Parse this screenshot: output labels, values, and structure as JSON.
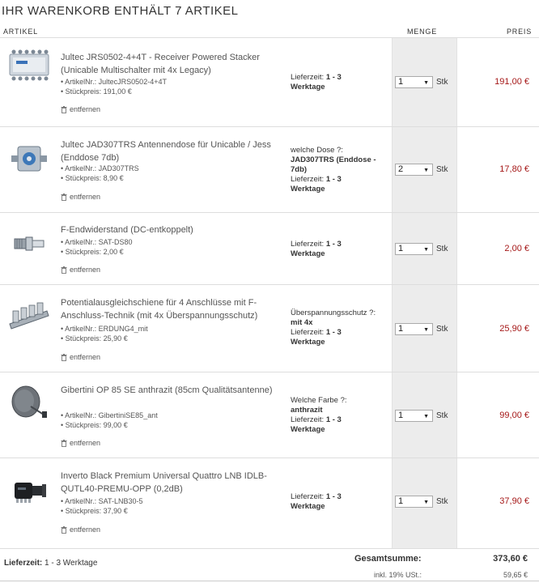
{
  "title": "IHR WARENKORB ENTHÄLT 7 ARTIKEL",
  "columns": {
    "artikel": "ARTIKEL",
    "menge": "MENGE",
    "preis": "PREIS"
  },
  "remove_label": "entfernen",
  "unit_label": "Stk",
  "items": [
    {
      "name": "Jultec JRS0502-4+4T - Receiver Powered Stacker (Unicable Multischalter mit 4x Legacy)",
      "artnr": "• ArtikelNr.: JultecJRS0502-4+4T",
      "stueckpreis": "• Stückpreis: 191,00 €",
      "info": {
        "variant_label": "",
        "variant_value": "",
        "lieferzeit_label": "Lieferzeit:",
        "lieferzeit_value": "1 - 3",
        "lieferzeit_unit": "Werktage"
      },
      "qty": "1",
      "price": "191,00 €"
    },
    {
      "name": "Jultec JAD307TRS Antennendose für Unicable / Jess (Enddose 7db)",
      "artnr": "• ArtikelNr.: JAD307TRS",
      "stueckpreis": "• Stückpreis: 8,90 €",
      "info": {
        "variant_label": "welche Dose ?:",
        "variant_value": "JAD307TRS (Enddose - 7db)",
        "lieferzeit_label": "Lieferzeit:",
        "lieferzeit_value": "1 - 3",
        "lieferzeit_unit": "Werktage"
      },
      "qty": "2",
      "price": "17,80 €"
    },
    {
      "name": "F-Endwiderstand (DC-entkoppelt)",
      "artnr": "• ArtikelNr.: SAT-DS80",
      "stueckpreis": "• Stückpreis: 2,00 €",
      "info": {
        "variant_label": "",
        "variant_value": "",
        "lieferzeit_label": "Lieferzeit:",
        "lieferzeit_value": "1 - 3",
        "lieferzeit_unit": "Werktage"
      },
      "qty": "1",
      "price": "2,00 €"
    },
    {
      "name": "Potentialausgleichschiene für 4 Anschlüsse mit F-Anschluss-Technik (mit 4x Überspannungsschutz)",
      "artnr": "• ArtikelNr.: ERDUNG4_mit",
      "stueckpreis": "• Stückpreis: 25,90 €",
      "info": {
        "variant_label": "Überspannungsschutz ?:",
        "variant_value": "mit 4x",
        "lieferzeit_label": "Lieferzeit:",
        "lieferzeit_value": "1 - 3",
        "lieferzeit_unit": "Werktage"
      },
      "qty": "1",
      "price": "25,90 €"
    },
    {
      "name": "Gibertini OP 85 SE anthrazit (85cm Qualitätsantenne)",
      "artnr": "• ArtikelNr.: GibertiniSE85_ant",
      "stueckpreis": "• Stückpreis: 99,00 €",
      "info": {
        "variant_label": "Welche Farbe ?:",
        "variant_value": "anthrazit",
        "lieferzeit_label": "Lieferzeit:",
        "lieferzeit_value": "1 - 3",
        "lieferzeit_unit": "Werktage"
      },
      "qty": "1",
      "price": "99,00 €"
    },
    {
      "name": "Inverto Black Premium Universal Quattro LNB IDLB-QUTL40-PREMU-OPP (0,2dB)",
      "artnr": "• ArtikelNr.: SAT-LNB30-5",
      "stueckpreis": "• Stückpreis: 37,90 €",
      "info": {
        "variant_label": "",
        "variant_value": "",
        "lieferzeit_label": "Lieferzeit:",
        "lieferzeit_value": "1 - 3",
        "lieferzeit_unit": "Werktage"
      },
      "qty": "1",
      "price": "37,90 €"
    }
  ],
  "footer": {
    "lieferzeit_label": "Lieferzeit:",
    "lieferzeit_value": "1 - 3 Werktage",
    "total_label": "Gesamtsumme:",
    "total_value": "373,60 €",
    "tax_label": "inkl. 19% USt.:",
    "tax_value": "59,65 €"
  },
  "colors": {
    "price": "#a51818",
    "qty_column_bg": "#ececec"
  },
  "icons": [
    "trash-icon",
    "select-arrow-icon",
    "multiswitch-image",
    "antenna-socket-image",
    "terminator-image",
    "grounding-bar-image",
    "satellite-dish-image",
    "lnb-image"
  ]
}
